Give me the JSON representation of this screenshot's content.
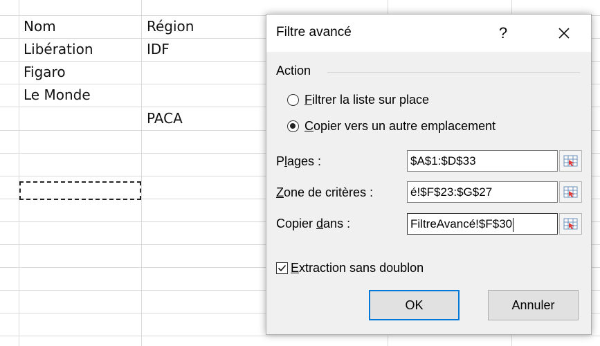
{
  "sheet": {
    "rows": [
      {
        "col_a": "Nom",
        "col_b": "Région"
      },
      {
        "col_a": "Libération",
        "col_b": "IDF"
      },
      {
        "col_a": "Figaro",
        "col_b": ""
      },
      {
        "col_a": "Le Monde",
        "col_b": ""
      },
      {
        "col_a": "",
        "col_b": "PACA"
      }
    ]
  },
  "dialog": {
    "title": "Filtre avancé",
    "help_label": "?",
    "action_group_label": "Action",
    "options": [
      {
        "mnemonic": "F",
        "rest": "iltrer la liste sur place",
        "selected": false
      },
      {
        "mnemonic": "C",
        "rest": "opier vers un autre emplacement",
        "selected": true
      }
    ],
    "fields": {
      "plages": {
        "label_before": "P",
        "label_mnemonic": "l",
        "label_after": "ages :",
        "value": "$A$1:$D$33"
      },
      "criteres": {
        "label_before": "",
        "label_mnemonic": "Z",
        "label_after": "one de critères :",
        "value": "é!$F$23:$G$27"
      },
      "copier": {
        "label_before": "Copier ",
        "label_mnemonic": "d",
        "label_after": "ans :",
        "value": "FiltreAvancé!$F$30"
      }
    },
    "checkbox": {
      "mnemonic": "E",
      "rest": "xtraction sans doublon",
      "checked": true
    },
    "buttons": {
      "ok": "OK",
      "cancel": "Annuler"
    }
  }
}
